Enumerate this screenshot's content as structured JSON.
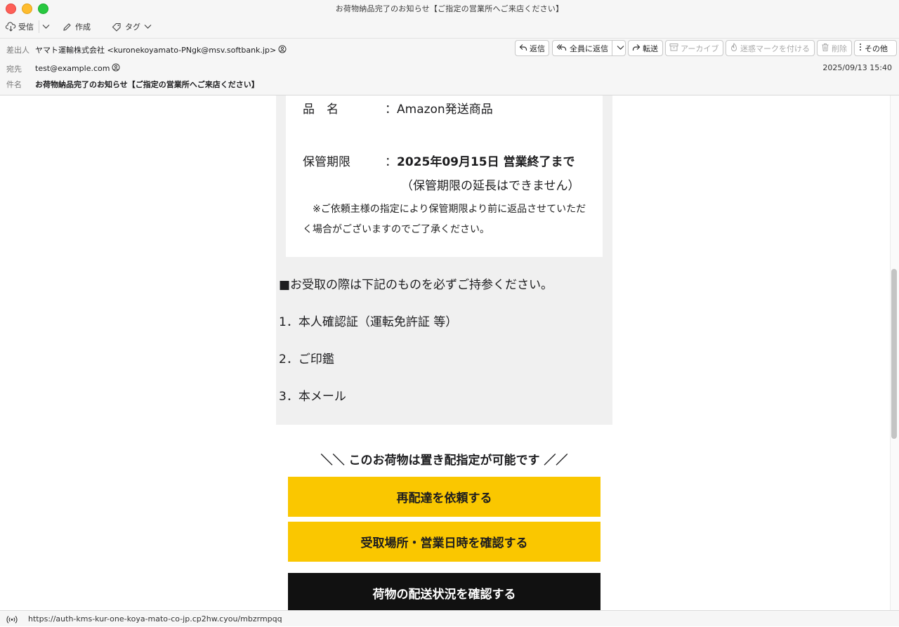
{
  "window": {
    "title": "お荷物納品完了のお知らせ【ご指定の営業所へご来店ください】"
  },
  "toolbar": {
    "receive": "受信",
    "compose": "作成",
    "tag": "タグ"
  },
  "header": {
    "from_label": "差出人",
    "from_value": "ヤマト運輸株式会社 <kuronekoyamato-PNgk@msv.softbank.jp>",
    "to_label": "宛先",
    "to_value": "test@example.com",
    "subject_label": "件名",
    "subject_value": "お荷物納品完了のお知らせ【ご指定の営業所へご来店ください】",
    "date": "2025/09/13 15:40",
    "actions": {
      "reply": "返信",
      "reply_all": "全員に返信",
      "forward": "転送",
      "archive": "アーカイブ",
      "junk": "迷惑マークを付ける",
      "delete": "削除",
      "other": "その他"
    }
  },
  "message": {
    "item_label": "品　名",
    "colon": "：",
    "item_value": "Amazon発送商品",
    "storage_label": "保管期限",
    "storage_value": "2025年09月15日 営業終了まで",
    "storage_note": "（保管期限の延長はできません）",
    "return_note": "　※ご依頼主様の指定により保管期限より前に返品させていただく場合がございますのでご了承ください。",
    "bring_heading": "■お受取の際は下記のものを必ずご持参ください。",
    "bring_items": [
      "1．本人確認証（運転免許証 等）",
      "2．ご印鑑",
      "3．本メール"
    ],
    "delivery_note": "＼＼ このお荷物は置き配指定が可能です ／／",
    "buttons": {
      "redelivery": "再配達を依頼する",
      "location": "受取場所・営業日時を確認する",
      "status": "荷物の配送状況を確認する"
    }
  },
  "statusbar": {
    "url": "https://auth-kms-kur-one-koya-mato-co-jp.cp2hw.cyou/mbzrmpqq"
  },
  "colors": {
    "yellow": "#fac700",
    "black": "#111111",
    "gray_block": "#f0f0f0"
  }
}
